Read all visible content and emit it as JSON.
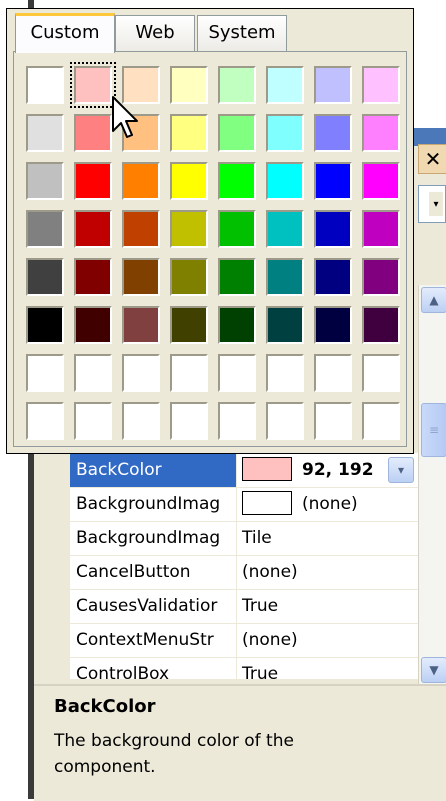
{
  "picker": {
    "tabs": [
      {
        "label": "Custom",
        "active": true
      },
      {
        "label": "Web",
        "active": false
      },
      {
        "label": "System",
        "active": false
      }
    ],
    "swatches": [
      [
        "#ffffff",
        "#ffc0c0",
        "#ffe0c0",
        "#ffffc0",
        "#c0ffc0",
        "#c0ffff",
        "#c0c0ff",
        "#ffc0ff"
      ],
      [
        "#e0e0e0",
        "#ff8080",
        "#ffc080",
        "#ffff80",
        "#80ff80",
        "#80ffff",
        "#8080ff",
        "#ff80ff"
      ],
      [
        "#c0c0c0",
        "#ff0000",
        "#ff8000",
        "#ffff00",
        "#00ff00",
        "#00ffff",
        "#0000ff",
        "#ff00ff"
      ],
      [
        "#808080",
        "#c00000",
        "#c04000",
        "#c0c000",
        "#00c000",
        "#00c0c0",
        "#0000c0",
        "#c000c0"
      ],
      [
        "#404040",
        "#800000",
        "#804000",
        "#808000",
        "#008000",
        "#008080",
        "#000080",
        "#800080"
      ],
      [
        "#000000",
        "#400000",
        "#804040",
        "#404000",
        "#004000",
        "#004040",
        "#000040",
        "#400040"
      ],
      [
        "#ffffff",
        "#ffffff",
        "#ffffff",
        "#ffffff",
        "#ffffff",
        "#ffffff",
        "#ffffff",
        "#ffffff"
      ],
      [
        "#ffffff",
        "#ffffff",
        "#ffffff",
        "#ffffff",
        "#ffffff",
        "#ffffff",
        "#ffffff",
        "#ffffff"
      ]
    ],
    "selected_swatch": "#ffc0c0"
  },
  "window": {
    "close_glyph": "✕",
    "dropdown_glyph": "▾"
  },
  "properties": [
    {
      "name": "BackColor",
      "value": "92, 192",
      "swatch": "#ffc0c0",
      "selected": true,
      "bold": true
    },
    {
      "name": "BackgroundImag",
      "value": "(none)",
      "swatch": "#ffffff"
    },
    {
      "name": "BackgroundImag",
      "value": "Tile"
    },
    {
      "name": "CancelButton",
      "value": "(none)"
    },
    {
      "name": "CausesValidatior",
      "value": "True"
    },
    {
      "name": "ContextMenuStr",
      "value": "(none)"
    },
    {
      "name": "ControlBox",
      "value": "True"
    }
  ],
  "description": {
    "title": "BackColor",
    "text": "The background color of the component."
  },
  "scrollbar": {
    "up_glyph": "▲",
    "down_glyph": "▼",
    "thumb_glyph": "≡"
  },
  "colors": {
    "selection": "#316ac5",
    "panel": "#ece9d8",
    "active_tab_accent": "#ffc83c"
  }
}
